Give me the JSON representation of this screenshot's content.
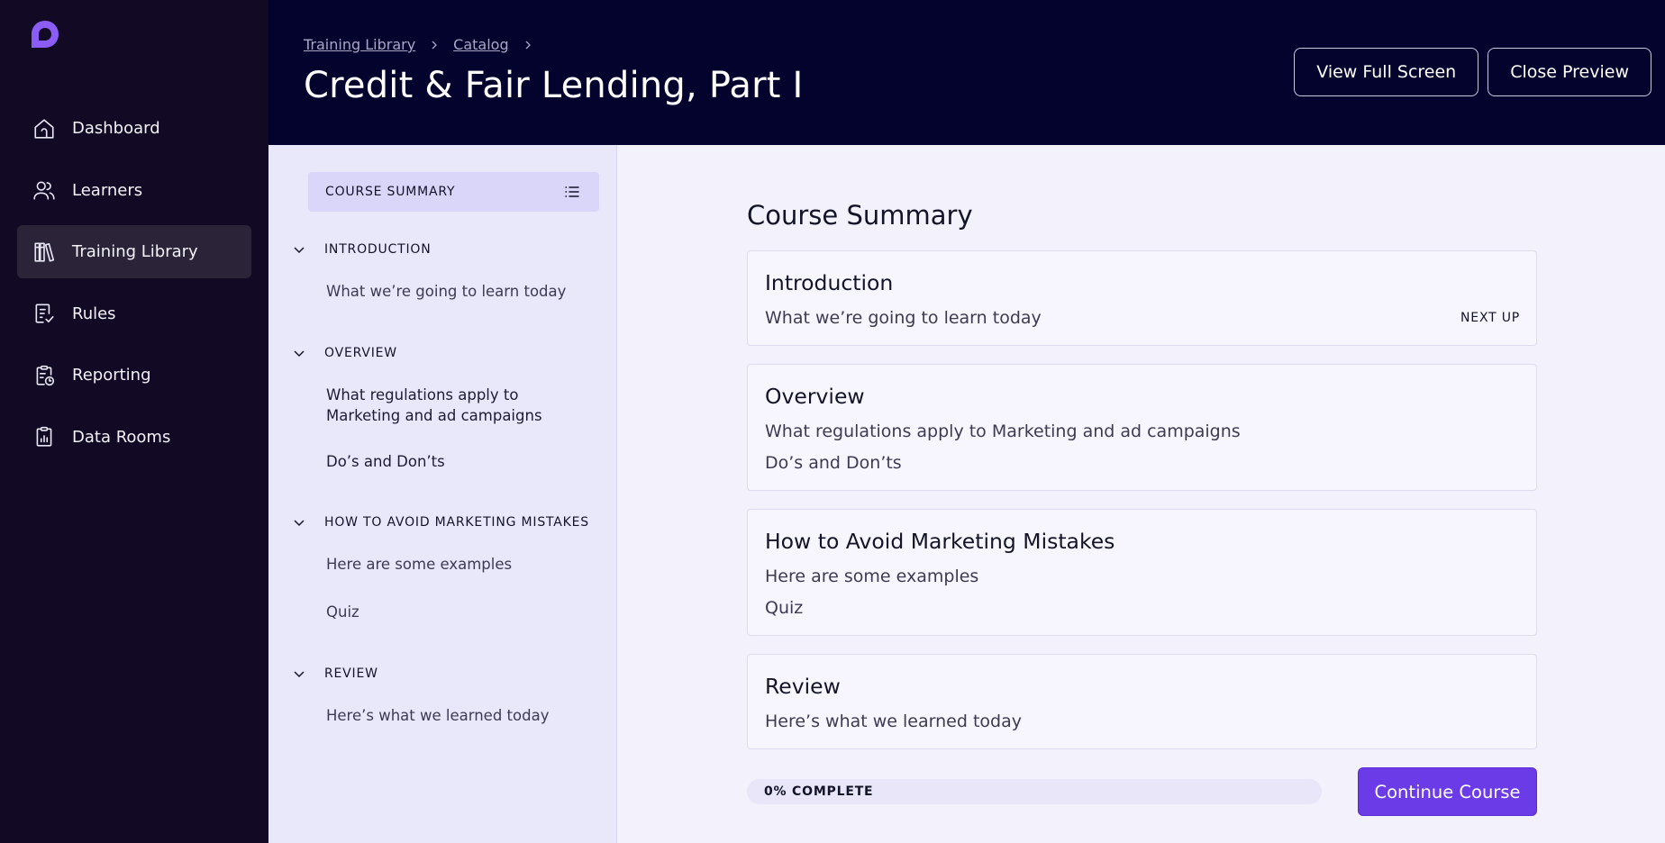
{
  "brand": {
    "accent": "#7b4af0",
    "sidebar_bg": "#120a24",
    "header_bg": "#03032e"
  },
  "sidebar": {
    "items": [
      {
        "label": "Dashboard",
        "icon": "home-icon",
        "active": false
      },
      {
        "label": "Learners",
        "icon": "users-icon",
        "active": false
      },
      {
        "label": "Training Library",
        "icon": "books-icon",
        "active": true
      },
      {
        "label": "Rules",
        "icon": "document-check-icon",
        "active": false
      },
      {
        "label": "Reporting",
        "icon": "clipboard-clock-icon",
        "active": false
      },
      {
        "label": "Data Rooms",
        "icon": "clipboard-chart-icon",
        "active": false
      }
    ]
  },
  "header": {
    "breadcrumb": [
      "Training Library",
      "Catalog"
    ],
    "title": "Credit & Fair Lending, Part I",
    "view_full_screen": "View Full Screen",
    "close_preview": "Close Preview"
  },
  "outline": {
    "heading": "COURSE SUMMARY",
    "sections": [
      {
        "title": "INTRODUCTION",
        "items": [
          "What we’re going to learn today"
        ]
      },
      {
        "title": "OVERVIEW",
        "items": [
          "What regulations apply to Marketing and ad campaigns",
          "Do’s and Don’ts"
        ]
      },
      {
        "title": "HOW TO AVOID MARKETING MISTAKES",
        "items": [
          "Here are some examples",
          "Quiz"
        ]
      },
      {
        "title": "REVIEW",
        "items": [
          "Here’s what we learned today"
        ]
      }
    ]
  },
  "main": {
    "title": "Course Summary",
    "cards": [
      {
        "title": "Introduction",
        "lines": [
          "What we’re going to learn today"
        ],
        "badge": "NEXT UP"
      },
      {
        "title": "Overview",
        "lines": [
          "What regulations apply to Marketing and ad campaigns",
          "Do’s and Don’ts"
        ]
      },
      {
        "title": "How to Avoid Marketing Mistakes",
        "lines": [
          "Here are some examples",
          "Quiz"
        ]
      },
      {
        "title": "Review",
        "lines": [
          "Here’s what we learned today"
        ]
      }
    ],
    "progress": {
      "percent": 0,
      "label": "0% COMPLETE"
    },
    "continue_label": "Continue Course"
  }
}
